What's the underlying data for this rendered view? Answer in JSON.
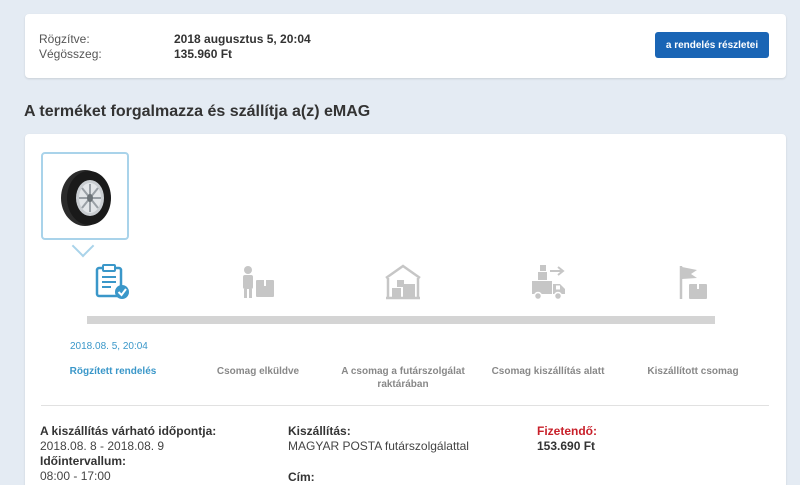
{
  "summary": {
    "recorded_label": "Rögzítve:",
    "recorded_value": "2018 augusztus 5, 20:04",
    "total_label": "Végösszeg:",
    "total_value": "135.960 Ft",
    "details_button": "a rendelés részletei"
  },
  "seller_title": "A terméket forgalmazza és szállítja a(z) eMAG",
  "product": {
    "image_icon": "tire-icon"
  },
  "steps": [
    {
      "icon": "order-recorded-icon",
      "label": "Rögzített rendelés",
      "date": "2018.08. 5, 20:04",
      "active": true
    },
    {
      "icon": "package-sent-icon",
      "label": "Csomag elküldve",
      "active": false
    },
    {
      "icon": "warehouse-icon",
      "label": "A csomag a futárszolgálat raktárában",
      "active": false
    },
    {
      "icon": "delivery-truck-icon",
      "label": "Csomag kiszállítás alatt",
      "active": false
    },
    {
      "icon": "delivered-flag-icon",
      "label": "Kiszállított csomag",
      "active": false
    }
  ],
  "delivery_info": {
    "expected_label": "A kiszállítás várható időpontja:",
    "expected_value": "2018.08. 8 - 2018.08. 9",
    "interval_label": "Időintervallum:",
    "interval_value": "08:00 - 17:00",
    "shipping_label": "Kiszállítás:",
    "shipping_value": "MAGYAR POSTA futárszolgálattal",
    "address_label": "Cím:",
    "payable_label": "Fizetendő:",
    "payable_value": "153.690 Ft"
  },
  "colors": {
    "accent": "#3a97c9",
    "button": "#1a65b5",
    "payable": "#c8202a",
    "background": "#e4ebf3"
  }
}
